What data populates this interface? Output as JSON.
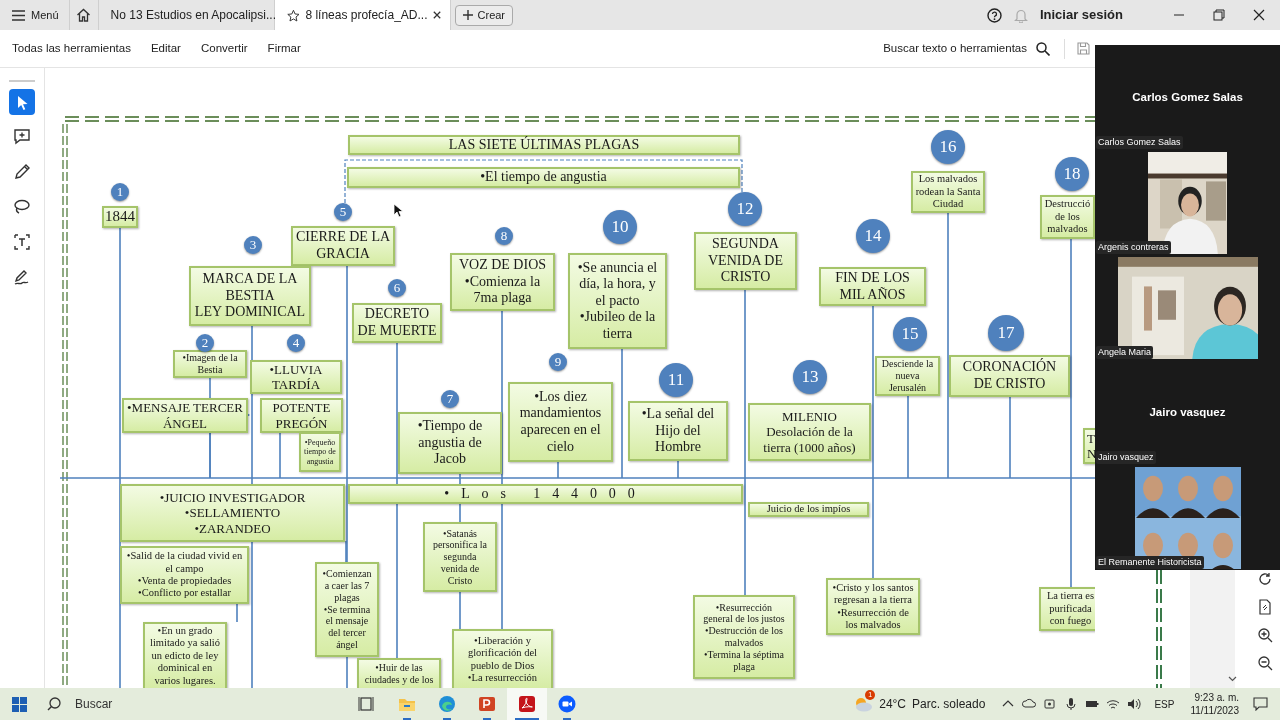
{
  "app": {
    "menu_label": "Menú",
    "tabs": [
      {
        "label": "No 13 Estudios en Apocalipsi...",
        "selected": false
      },
      {
        "label": "8 líneas profecía_AD...",
        "selected": true
      }
    ],
    "new_button": "Crear",
    "sign_in": "Iniciar sesión"
  },
  "toolbar": {
    "items": [
      "Todas las herramientas",
      "Editar",
      "Convertir",
      "Firmar"
    ],
    "search_label": "Buscar texto o herramientas"
  },
  "left_tools": [
    {
      "kind": "select",
      "selected": true
    },
    {
      "kind": "comment",
      "selected": false
    },
    {
      "kind": "pen",
      "selected": false
    },
    {
      "kind": "lasso",
      "selected": false
    },
    {
      "kind": "textbox",
      "selected": false
    },
    {
      "kind": "sign",
      "selected": false
    }
  ],
  "diagram": {
    "boxes": [
      "LAS SIETE ÚLTIMAS PLAGAS",
      "•El tiempo de angustia",
      "1844",
      "CIERRE DE LA\nGRACIA",
      "MARCA DE LA\nBESTIA\nLEY DOMINICAL",
      "DECRETO\nDE MUERTE",
      "VOZ DE DIOS\n•Comienza la\n7ma plaga",
      "•Se anuncia el\ndía, la hora, y\nel pacto\n•Jubileo de la\ntierra",
      "SEGUNDA\nVENIDA DE\nCRISTO",
      "FIN DE LOS\nMIL AÑOS",
      "Los malvados\nrodean la Santa\nCiudad",
      "Destrucció\nde los\nmalvados",
      "•Imagen de la\nBestia",
      "•LLUVIA\nTARDÍA",
      "•MENSAJE TERCER\nÁNGEL",
      "POTENTE\nPREGÓN",
      "•Pequeño\ntiempo de\nangustia",
      "•Tiempo de\nangustia de\nJacob",
      "•Los diez\nmandamientos\naparecen en el\ncielo",
      "•La señal del\nHijo del\nHombre",
      "MILENIO\nDesolación de la\ntierra (1000 años)",
      "Desciende la\nnueva\nJerusalén",
      "CORONACIÓN\nDE CRISTO",
      "T\nN",
      "•JUICIO INVESTIGADOR\n•SELLAMIENTO\n•ZARANDEO",
      "•Los 144000",
      "Juicio de los impíos",
      "•Salid de la ciudad vivid en\nel campo\n•Venta de propiedades\n•Conflicto por estallar",
      "•Satanás\npersonifica la\nsegunda\nvenida de\nCristo",
      "•Comienzan\na caer las 7\nplagas\n•Se termina\nel mensaje\ndel tercer\nángel",
      "•En un grado\nlimitado ya salió\nun edicto de ley\ndominical en\nvarios lugares.",
      "•Huir de las\nciudades y de los",
      "•Liberación y\nglorificación del\npueblo de Dios\n•La resurrección",
      "•Resurrección\ngeneral de los justos\n•Destrucción de los\nmalvados\n•Termina la séptima\nplaga",
      "•Cristo y los santos\nregresan a la tierra\n•Resurrección de\nlos malvados",
      "La tierra es\npurificada\ncon fuego"
    ],
    "markers": [
      "1",
      "2",
      "3",
      "4",
      "5",
      "6",
      "7",
      "8",
      "9",
      "10",
      "11",
      "12",
      "13",
      "14",
      "15",
      "16",
      "17",
      "18"
    ]
  },
  "meeting": {
    "tiles": [
      {
        "kind": "avatar",
        "heading": "Carlos Gomez Salas",
        "label": "Carlos Gomez Salas"
      },
      {
        "kind": "video",
        "label": "Argenis contreras"
      },
      {
        "kind": "video",
        "label": "Angela Maria"
      },
      {
        "kind": "avatar",
        "heading": "Jairo vasquez",
        "label": "Jairo vasquez"
      },
      {
        "kind": "video",
        "label": "El Remanente Historicista"
      }
    ]
  },
  "taskbar": {
    "search_placeholder": "Buscar",
    "apps": [
      {
        "kind": "taskview",
        "selected": false
      },
      {
        "kind": "files",
        "selected": false
      },
      {
        "kind": "edge",
        "selected": false
      },
      {
        "kind": "powerpoint",
        "selected": false
      },
      {
        "kind": "acrobat",
        "selected": true
      },
      {
        "kind": "zoom",
        "selected": false
      }
    ],
    "weather_badge": "1",
    "temperature": "24°C",
    "weather": "Parc. soleado",
    "language": "ESP",
    "time": "9:23 a. m.",
    "date": "11/11/2023"
  }
}
